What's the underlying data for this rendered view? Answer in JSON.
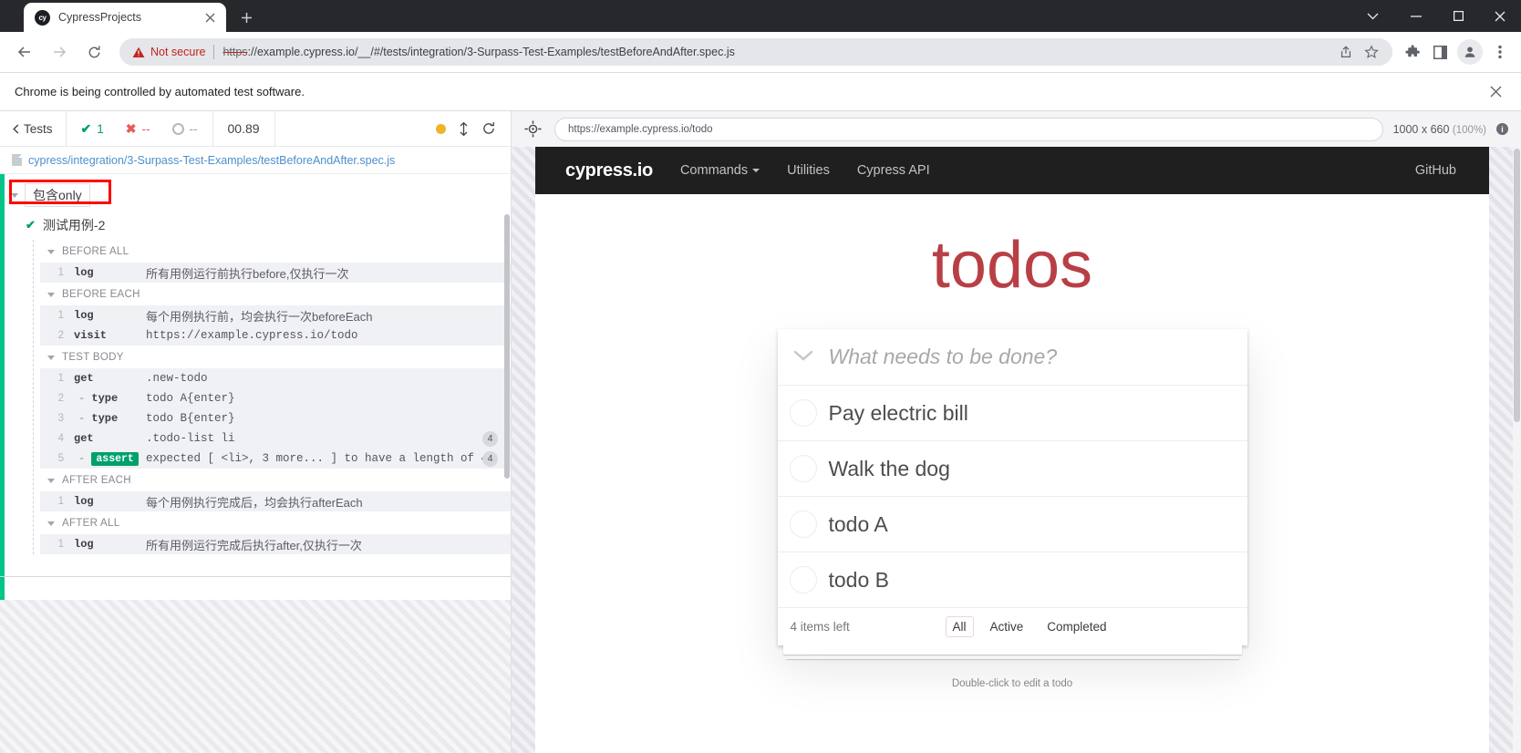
{
  "browser": {
    "tab": {
      "title": "CypressProjects",
      "favicon_label": "cy",
      "close_icon": "close-icon"
    },
    "new_tab_label": "+",
    "window_controls": {
      "chevron": "⌄",
      "minimize": "—",
      "maximize": "▢",
      "close": "✕"
    },
    "nav": {
      "back": "←",
      "forward": "→",
      "reload": "⟳"
    },
    "omnibox": {
      "security_label": "Not secure",
      "url_scheme": "https",
      "url_rest": "://example.cypress.io/__/#/tests/integration/3-Surpass-Test-Examples/testBeforeAndAfter.spec.js",
      "share_icon": "share-icon",
      "bookmark_icon": "star-icon"
    },
    "toolbar_icons": [
      "extensions-icon",
      "side-panel-icon",
      "profile-avatar-icon",
      "more-menu-icon"
    ],
    "infobar": {
      "text": "Chrome is being controlled by automated test software.",
      "close_icon": "close-icon"
    }
  },
  "reporter": {
    "back_label": "Tests",
    "stats": {
      "passed": {
        "glyph": "✔",
        "value": "1"
      },
      "failed": {
        "glyph": "✖",
        "value": "--"
      },
      "pending": {
        "value": "--"
      }
    },
    "timer": "00.89",
    "controls": {
      "studio_dot": "amber-dot",
      "resize_icon": "resize-vertical-icon",
      "restart_icon": "restart-icon"
    },
    "spec_path": "cypress/integration/3-Surpass-Test-Examples/testBeforeAndAfter.spec.js",
    "suite": {
      "title": "包含only"
    },
    "test": {
      "title": "测试用例-2"
    },
    "hooks": [
      {
        "label": "BEFORE ALL",
        "commands": [
          {
            "num": "1",
            "name": "log",
            "child": false,
            "message": "所有用例运行前执行before,仅执行一次",
            "cn": true,
            "shade": true,
            "badge": ""
          }
        ]
      },
      {
        "label": "BEFORE EACH",
        "commands": [
          {
            "num": "1",
            "name": "log",
            "child": false,
            "message": "每个用例执行前，均会执行一次beforeEach",
            "cn": true,
            "shade": true,
            "badge": ""
          },
          {
            "num": "2",
            "name": "visit",
            "child": false,
            "message": "https://example.cypress.io/todo",
            "cn": false,
            "shade": true,
            "badge": ""
          }
        ]
      },
      {
        "label": "TEST BODY",
        "commands": [
          {
            "num": "1",
            "name": "get",
            "child": false,
            "message": ".new-todo",
            "cn": false,
            "shade": true,
            "badge": ""
          },
          {
            "num": "2",
            "name": "type",
            "child": true,
            "message": "todo A{enter}",
            "cn": false,
            "shade": true,
            "badge": ""
          },
          {
            "num": "3",
            "name": "type",
            "child": true,
            "message": "todo B{enter}",
            "cn": false,
            "shade": true,
            "badge": ""
          },
          {
            "num": "4",
            "name": "get",
            "child": false,
            "message": ".todo-list li",
            "cn": false,
            "shade": true,
            "badge": "4"
          },
          {
            "num": "5",
            "name": "assert",
            "child": true,
            "assert": true,
            "message": "expected  [ <li>, 3 more... ]  to have a length of  4",
            "cn": false,
            "shade": true,
            "badge": "4"
          }
        ]
      },
      {
        "label": "AFTER EACH",
        "commands": [
          {
            "num": "1",
            "name": "log",
            "child": false,
            "message": "每个用例执行完成后，均会执行afterEach",
            "cn": true,
            "shade": true,
            "badge": ""
          }
        ]
      },
      {
        "label": "AFTER ALL",
        "commands": [
          {
            "num": "1",
            "name": "log",
            "child": false,
            "message": "所有用例运行完成后执行after,仅执行一次",
            "cn": true,
            "shade": true,
            "badge": ""
          }
        ]
      }
    ]
  },
  "aut": {
    "selector_icon": "selector-playground-icon",
    "url": "https://example.cypress.io/todo",
    "viewport": "1000 x 660",
    "viewport_scale": "(100%)",
    "info_icon": "info-icon",
    "site_nav": {
      "brand": "cypress.io",
      "links": [
        "Commands",
        "Utilities",
        "Cypress API"
      ],
      "right_link": "GitHub"
    },
    "todo": {
      "title": "todos",
      "toggle_all_icon": "chevron-down-icon",
      "placeholder": "What needs to be done?",
      "items": [
        {
          "label": "Pay electric bill",
          "done": false
        },
        {
          "label": "Walk the dog",
          "done": false
        },
        {
          "label": "todo A",
          "done": false
        },
        {
          "label": "todo B",
          "done": false
        }
      ],
      "count_text": "4 items left",
      "filters": [
        {
          "label": "All",
          "selected": true
        },
        {
          "label": "Active",
          "selected": false
        },
        {
          "label": "Completed",
          "selected": false
        }
      ],
      "hint": "Double-click to edit a todo"
    }
  },
  "colors": {
    "cypress_green": "#00c58a",
    "pass_green": "#00a06d",
    "fail_red": "#e45b5b",
    "todo_red": "#b83f45",
    "highlight_red": "#ff0000",
    "amber": "#f0b429"
  }
}
